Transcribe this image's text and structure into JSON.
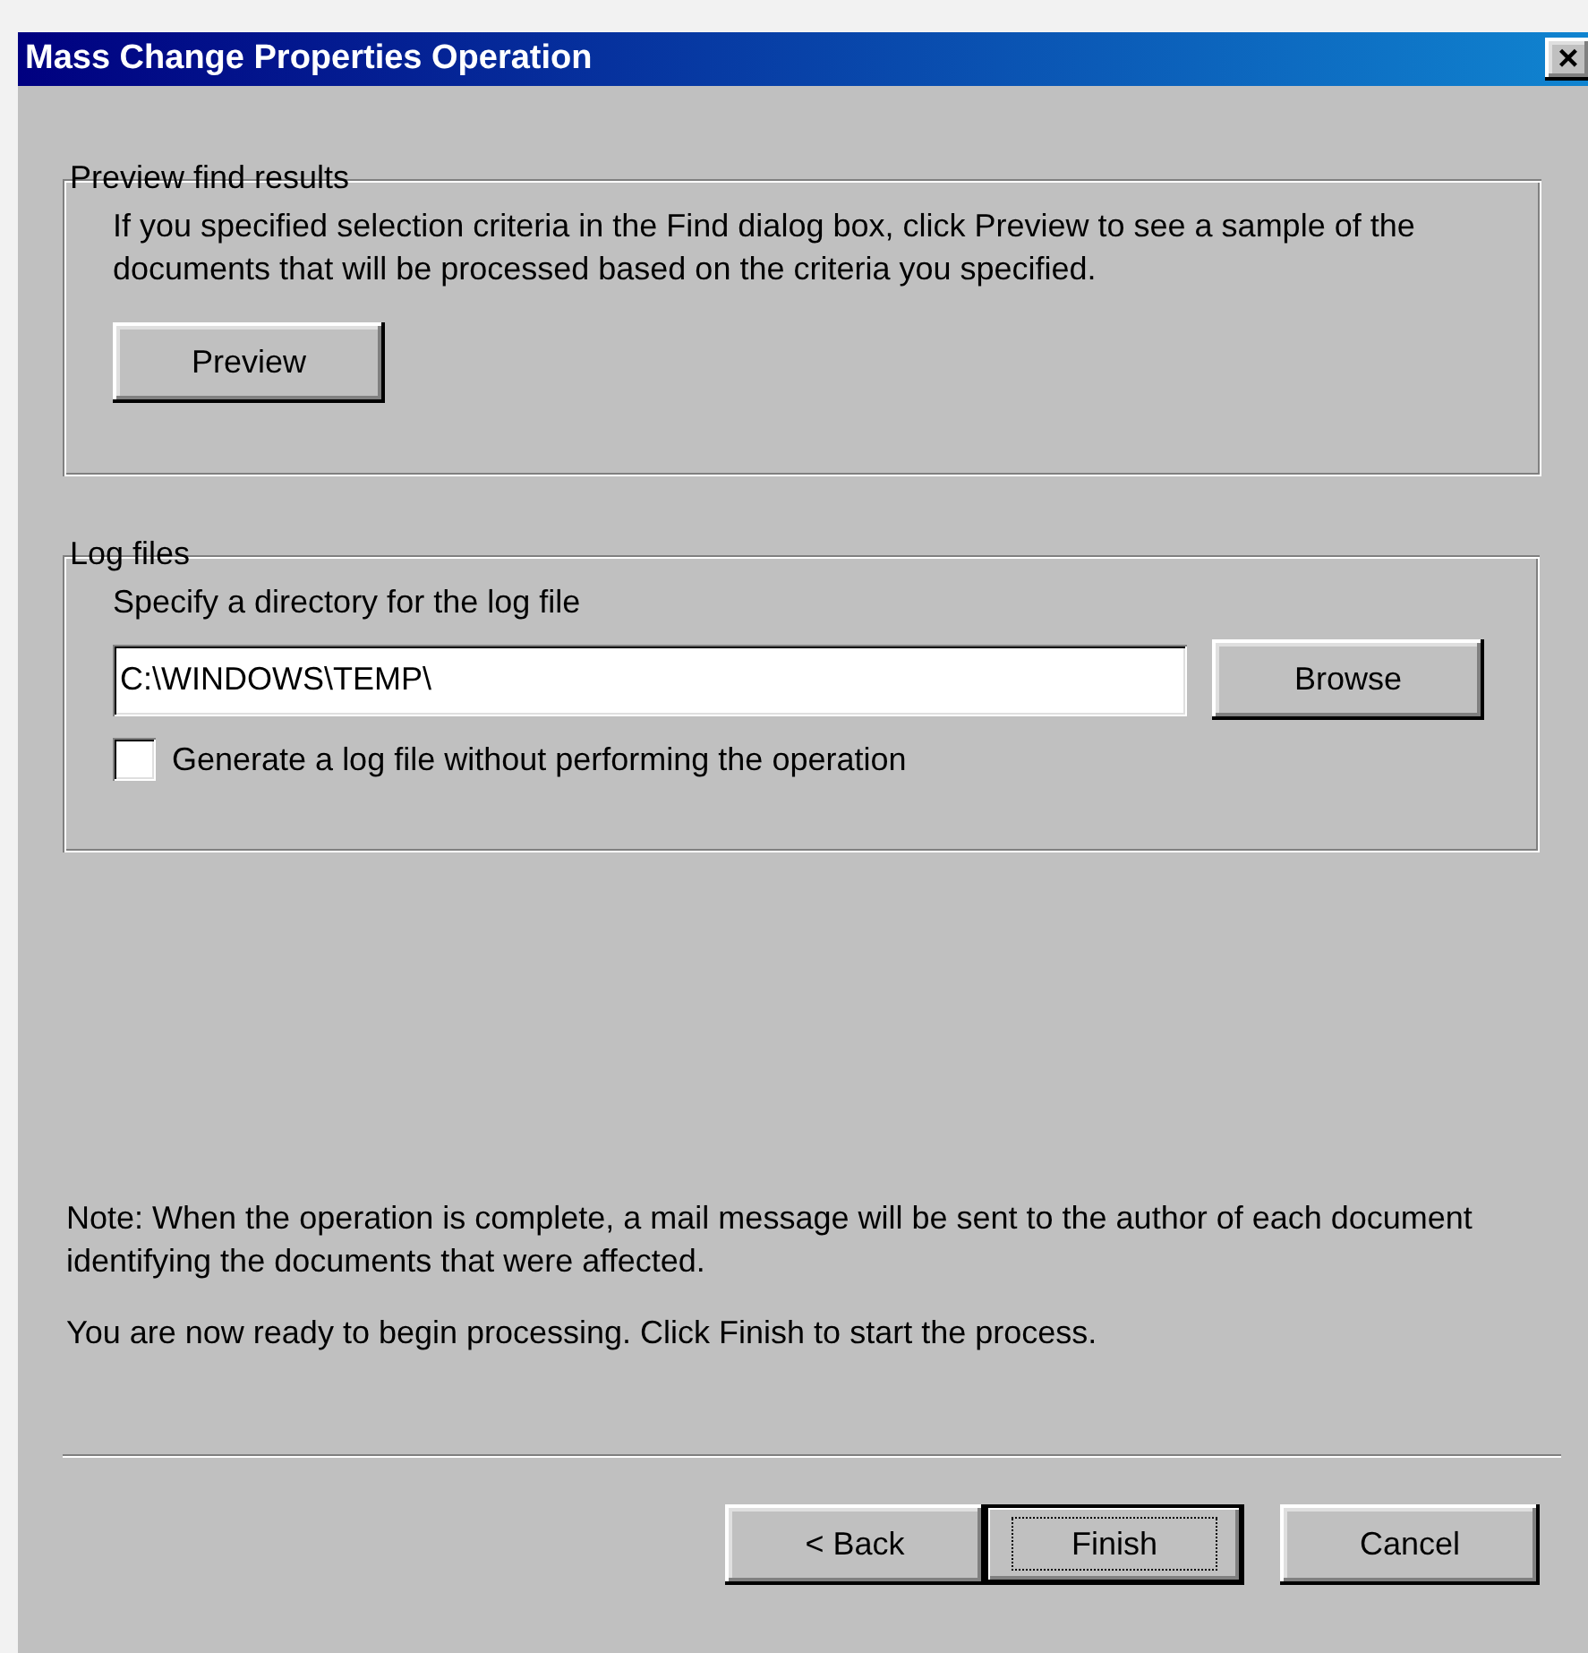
{
  "window": {
    "title": "Mass Change Properties Operation",
    "close_label": "×"
  },
  "preview_group": {
    "legend": "Preview find results",
    "description": "If you specified selection criteria in the Find dialog box, click Preview to see a sample of the documents that will be processed based on the criteria you specified.",
    "button": {
      "label": "Preview"
    }
  },
  "log_group": {
    "legend": "Log files",
    "field_label": "Specify a directory for the log file",
    "directory": "C:\\WINDOWS\\TEMP\\",
    "browse_button": {
      "label": "Browse"
    },
    "checkbox": {
      "label": "Generate a log file without performing the operation",
      "checked": false
    }
  },
  "note": "Note: When the operation is complete, a mail message will be sent to the author of each document identifying the documents that were affected.",
  "ready_text": "You are now ready to begin processing. Click Finish to start the process.",
  "buttons": [
    {
      "label": "< Back",
      "default": false
    },
    {
      "label": "Finish",
      "default": true
    },
    {
      "label": "Cancel",
      "default": false
    }
  ]
}
